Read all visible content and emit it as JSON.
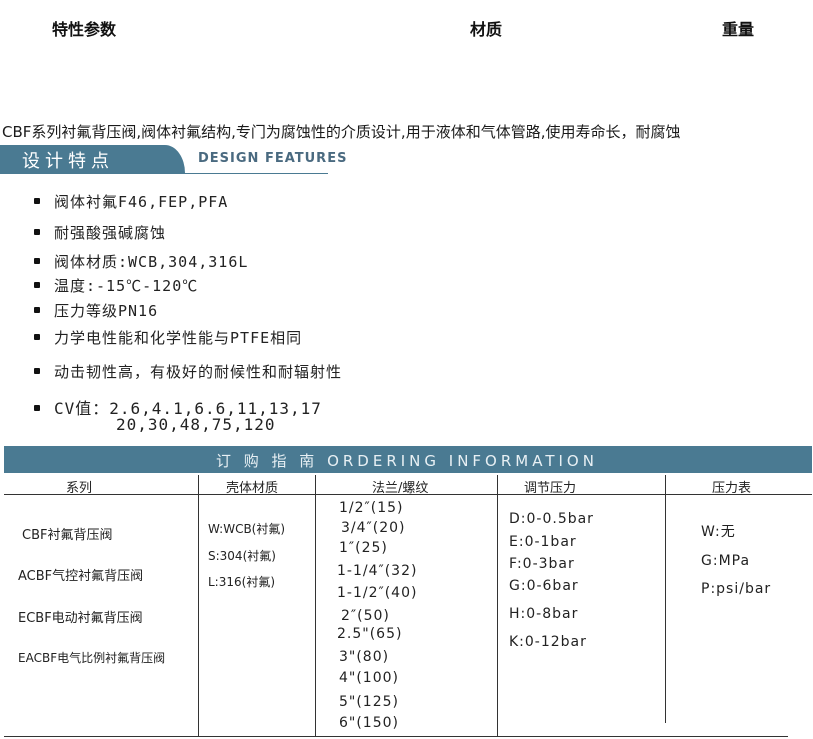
{
  "table_header": {
    "col1": "特性参数",
    "col2": "材质",
    "col3": "重量"
  },
  "intro": "CBF系列衬氟背压阀,阀体衬氟结构,专门为腐蚀性的介质设计,用于液体和气体管路,使用寿命长，耐腐蚀",
  "design_features": {
    "title_cn": "设计特点",
    "title_en": "DESIGN FEATURES",
    "items": [
      "阀体衬氟F46,FEP,PFA",
      "耐强酸强碱腐蚀",
      "阀体材质:WCB,304,316L",
      "温度:-15℃-120℃",
      "压力等级PN16",
      "力学电性能和化学性能与PTFE相同",
      "动击韧性高，有极好的耐候性和耐辐射性",
      "CV值：2.6,4.1,6.6,11,13,17",
      "20,30,48,75,120"
    ]
  },
  "ordering": {
    "title": "订 购 指 南   ORDERING  INFORMATION",
    "columns": [
      "系列",
      "壳体材质",
      "法兰/螺纹",
      "调节压力",
      "压力表"
    ],
    "series": [
      "CBF衬氟背压阀",
      "ACBF气控衬氟背压阀",
      "ECBF电动衬氟背压阀",
      "EACBF电气比例衬氟背压阀"
    ],
    "materials": [
      "W:WCB(衬氟)",
      "S:304(衬氟)",
      "L:316(衬氟)"
    ],
    "flanges": [
      "1/2″(15)",
      "3/4″(20)",
      "1″(25)",
      "1-1/4″(32)",
      "1-1/2″(40)",
      "2″(50)",
      "2.5\"(65)",
      "3\"(80)",
      "4\"(100)",
      "5\"(125)",
      "6\"(150)"
    ],
    "pressures": [
      "D:0-0.5bar",
      "E:0-1bar",
      "F:0-3bar",
      "G:0-6bar",
      "H:0-8bar",
      "K:0-12bar"
    ],
    "gauges": [
      "W:无",
      "G:MPa",
      "P:psi/bar"
    ]
  }
}
